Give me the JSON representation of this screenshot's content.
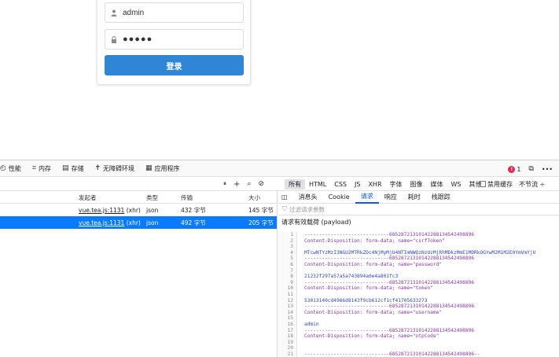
{
  "login": {
    "username_value": "admin",
    "password_value": "●●●●●",
    "submit_label": "登录"
  },
  "devtools": {
    "tabs": [
      {
        "label": "性能",
        "icon": "performance-icon"
      },
      {
        "label": "内存",
        "icon": "memory-icon"
      },
      {
        "label": "存储",
        "icon": "storage-icon"
      },
      {
        "label": "无障碍环境",
        "icon": "accessibility-icon"
      },
      {
        "label": "应用程序",
        "icon": "application-icon"
      }
    ],
    "error_count": "1",
    "more": "•••"
  },
  "toolbar": {
    "filters": [
      "所有",
      "HTML",
      "CSS",
      "JS",
      "XHR",
      "字体",
      "图像",
      "媒体",
      "WS",
      "其他"
    ],
    "disable_cache": "禁用缓存",
    "throttle": "不节流 ÷"
  },
  "request_list": {
    "headers": {
      "initiator": "发起者",
      "type": "类型",
      "transferred": "传输",
      "size": "大小"
    },
    "rows": [
      {
        "initiator": "vue.tea.js:1131",
        "initiator_suffix": "(xhr)",
        "type": "json",
        "transferred": "432 字节",
        "size": "145 字节"
      },
      {
        "initiator": "vue.tea.js:1131",
        "initiator_suffix": "(xhr)",
        "type": "json",
        "transferred": "492 字节",
        "size": "205 字节"
      }
    ]
  },
  "details": {
    "tabs": [
      "消息头",
      "Cookie",
      "请求",
      "响应",
      "耗时",
      "栈跟踪"
    ],
    "active_tab": "请求",
    "filter_placeholder": "过滤请求参数",
    "section_title": "请求有效载荷 (payload)",
    "payload_lines": [
      {
        "n": "1",
        "t": "-----------------------------68528721310142288134542498896",
        "c": "purple"
      },
      {
        "n": "2",
        "t": "Content-Disposition: form-data; name=\"csrfToken\"",
        "c": "purple"
      },
      {
        "n": "3",
        "t": "",
        "c": "purple"
      },
      {
        "n": "4",
        "t": "MTcwNTYzMzI3NGU2MTRkZDc4NjMyMjU4NTImNWQzNzUzMjRhMDkzMmE1MDRkOGYwM2M1M2E0YmVmYjU",
        "c": "blue"
      },
      {
        "n": "5",
        "t": "-----------------------------68528721310142288134542498896",
        "c": "purple"
      },
      {
        "n": "6",
        "t": "Content-Disposition: form-data; name=\"password\"",
        "c": "purple"
      },
      {
        "n": "7",
        "t": "",
        "c": "purple"
      },
      {
        "n": "8",
        "t": "21232f297a57a5a743894a0e4a801fc3",
        "c": "blue"
      },
      {
        "n": "9",
        "t": "-----------------------------68528721310142288134542498896",
        "c": "purple"
      },
      {
        "n": "10",
        "t": "Content-Disposition: form-data; name=\"token\"",
        "c": "purple"
      },
      {
        "n": "11",
        "t": "",
        "c": "purple"
      },
      {
        "n": "12",
        "t": "53013140cd4966d8143f9cb612cf1cf41705633273",
        "c": "blue"
      },
      {
        "n": "13",
        "t": "-----------------------------68528721310142288134542498896",
        "c": "purple"
      },
      {
        "n": "14",
        "t": "Content-Disposition: form-data; name=\"username\"",
        "c": "purple"
      },
      {
        "n": "15",
        "t": "",
        "c": "purple"
      },
      {
        "n": "16",
        "t": "admin",
        "c": "blue"
      },
      {
        "n": "17",
        "t": "-----------------------------68528721310142288134542498896",
        "c": "purple"
      },
      {
        "n": "18",
        "t": "Content-Disposition: form-data; name=\"otpCode\"",
        "c": "purple"
      },
      {
        "n": "19",
        "t": "",
        "c": "purple"
      },
      {
        "n": "20",
        "t": "",
        "c": "purple"
      },
      {
        "n": "21",
        "t": "-----------------------------68528721310142288134542498896--",
        "c": "purple"
      }
    ]
  },
  "colors": {
    "primary": "#2f86d6",
    "selection": "#0a7aff",
    "active_tab": "#0a60d6"
  }
}
